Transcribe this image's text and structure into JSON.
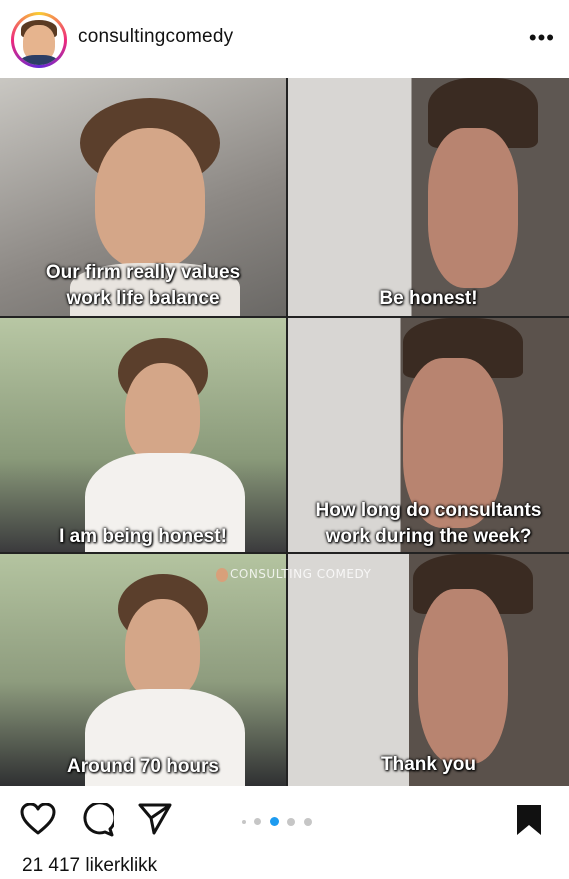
{
  "header": {
    "username": "consultingcomedy",
    "more_label": "•••",
    "avatar_icon": "cartoon-avatar-icon"
  },
  "post": {
    "watermark": "CONSULTING COMEDY",
    "panels": [
      {
        "caption": [
          "Our firm really values",
          "work life balance"
        ]
      },
      {
        "caption": [
          "Be honest!"
        ]
      },
      {
        "caption": [
          "I am being honest!"
        ]
      },
      {
        "caption": [
          "How long do consultants",
          "work during the week?"
        ]
      },
      {
        "caption": [
          "Around 70 hours"
        ]
      },
      {
        "caption": [
          "Thank you"
        ]
      }
    ]
  },
  "actions": {
    "like_icon": "heart-icon",
    "comment_icon": "comment-icon",
    "share_icon": "send-icon",
    "save_icon": "bookmark-icon",
    "carousel": {
      "count": 5,
      "active_index": 2
    }
  },
  "likes": {
    "text": "21 417 likerklikk"
  },
  "colors": {
    "accent": "#1d9bf0",
    "text": "#111111"
  }
}
